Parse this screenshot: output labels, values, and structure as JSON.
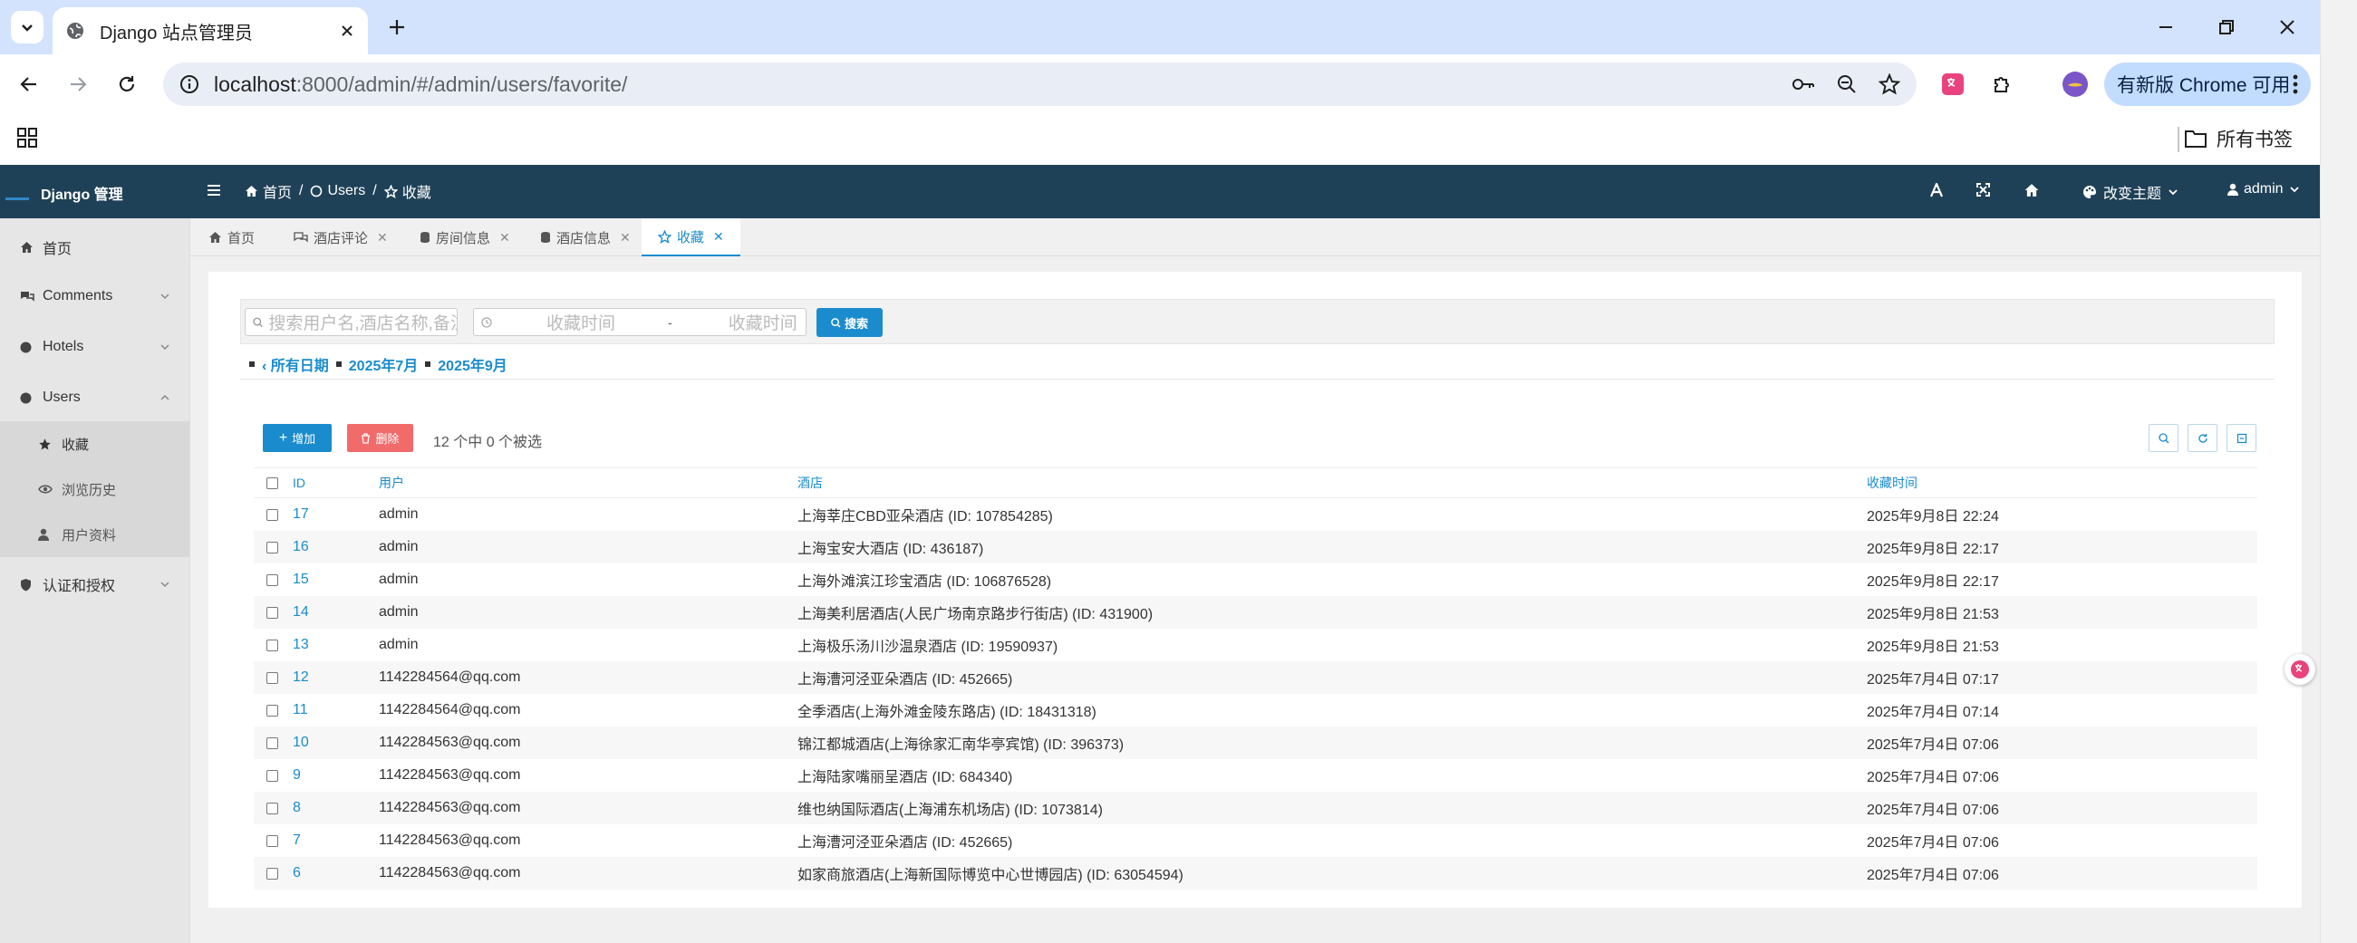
{
  "browser": {
    "tab_title": "Django 站点管理员",
    "url_host": "localhost",
    "url_path": ":8000/admin/#/admin/users/favorite/",
    "update_label": "有新版 Chrome 可用",
    "all_bookmarks": "所有书签"
  },
  "header": {
    "brand": "Django 管理",
    "breadcrumb": [
      "首页",
      "Users",
      "收藏"
    ],
    "theme_label": "改变主题",
    "user_label": "admin"
  },
  "sidebar": {
    "items": [
      {
        "label": "首页",
        "icon": "home-icon"
      },
      {
        "label": "Comments",
        "icon": "comments-icon"
      },
      {
        "label": "Hotels",
        "icon": "circle-icon"
      },
      {
        "label": "Users",
        "icon": "circle-icon"
      },
      {
        "label": "认证和授权",
        "icon": "shield-icon"
      }
    ],
    "users_sub": [
      {
        "label": "收藏",
        "icon": "star-icon"
      },
      {
        "label": "浏览历史",
        "icon": "eye-icon"
      },
      {
        "label": "用户资料",
        "icon": "user-icon"
      }
    ]
  },
  "page_tabs": [
    {
      "label": "首页",
      "icon": "home-icon"
    },
    {
      "label": "酒店评论",
      "icon": "comments-icon"
    },
    {
      "label": "房间信息",
      "icon": "database-icon"
    },
    {
      "label": "酒店信息",
      "icon": "database-icon"
    },
    {
      "label": "收藏",
      "icon": "star-icon"
    }
  ],
  "filter": {
    "search_placeholder": "搜索用户名,酒店名称,备注",
    "date_start": "收藏时间",
    "date_sep": "-",
    "date_end": "收藏时间",
    "search_button": "搜索"
  },
  "date_nav": {
    "all": "‹ 所有日期",
    "months": [
      "2025年7月",
      "2025年9月"
    ]
  },
  "actions": {
    "add": "增加",
    "delete": "删除",
    "selection": "12 个中 0 个被选"
  },
  "table": {
    "headers": [
      "ID",
      "用户",
      "酒店",
      "收藏时间"
    ],
    "rows": [
      {
        "id": "17",
        "user": "admin",
        "hotel": "上海莘庄CBD亚朵酒店 (ID: 107854285)",
        "time": "2025年9月8日 22:24"
      },
      {
        "id": "16",
        "user": "admin",
        "hotel": "上海宝安大酒店 (ID: 436187)",
        "time": "2025年9月8日 22:17"
      },
      {
        "id": "15",
        "user": "admin",
        "hotel": "上海外滩滨江珍宝酒店 (ID: 106876528)",
        "time": "2025年9月8日 22:17"
      },
      {
        "id": "14",
        "user": "admin",
        "hotel": "上海美利居酒店(人民广场南京路步行街店) (ID: 431900)",
        "time": "2025年9月8日 21:53"
      },
      {
        "id": "13",
        "user": "admin",
        "hotel": "上海极乐汤川沙温泉酒店 (ID: 19590937)",
        "time": "2025年9月8日 21:53"
      },
      {
        "id": "12",
        "user": "1142284564@qq.com",
        "hotel": "上海漕河泾亚朵酒店 (ID: 452665)",
        "time": "2025年7月4日 07:17"
      },
      {
        "id": "11",
        "user": "1142284564@qq.com",
        "hotel": "全季酒店(上海外滩金陵东路店) (ID: 18431318)",
        "time": "2025年7月4日 07:14"
      },
      {
        "id": "10",
        "user": "1142284563@qq.com",
        "hotel": "锦江都城酒店(上海徐家汇南华亭宾馆) (ID: 396373)",
        "time": "2025年7月4日 07:06"
      },
      {
        "id": "9",
        "user": "1142284563@qq.com",
        "hotel": "上海陆家嘴丽呈酒店 (ID: 684340)",
        "time": "2025年7月4日 07:06"
      },
      {
        "id": "8",
        "user": "1142284563@qq.com",
        "hotel": "维也纳国际酒店(上海浦东机场店) (ID: 1073814)",
        "time": "2025年7月4日 07:06"
      },
      {
        "id": "7",
        "user": "1142284563@qq.com",
        "hotel": "上海漕河泾亚朵酒店 (ID: 452665)",
        "time": "2025年7月4日 07:06"
      },
      {
        "id": "6",
        "user": "1142284563@qq.com",
        "hotel": "如家商旅酒店(上海新国际博览中心世博园店) (ID: 63054594)",
        "time": "2025年7月4日 07:06"
      }
    ]
  },
  "colors": {
    "header_bg": "#1f4157",
    "accent": "#1a8ccd",
    "add_button": "#1a8ccd",
    "delete_button": "#f26b6b",
    "browser_tabstrip": "#d3e3fd"
  }
}
